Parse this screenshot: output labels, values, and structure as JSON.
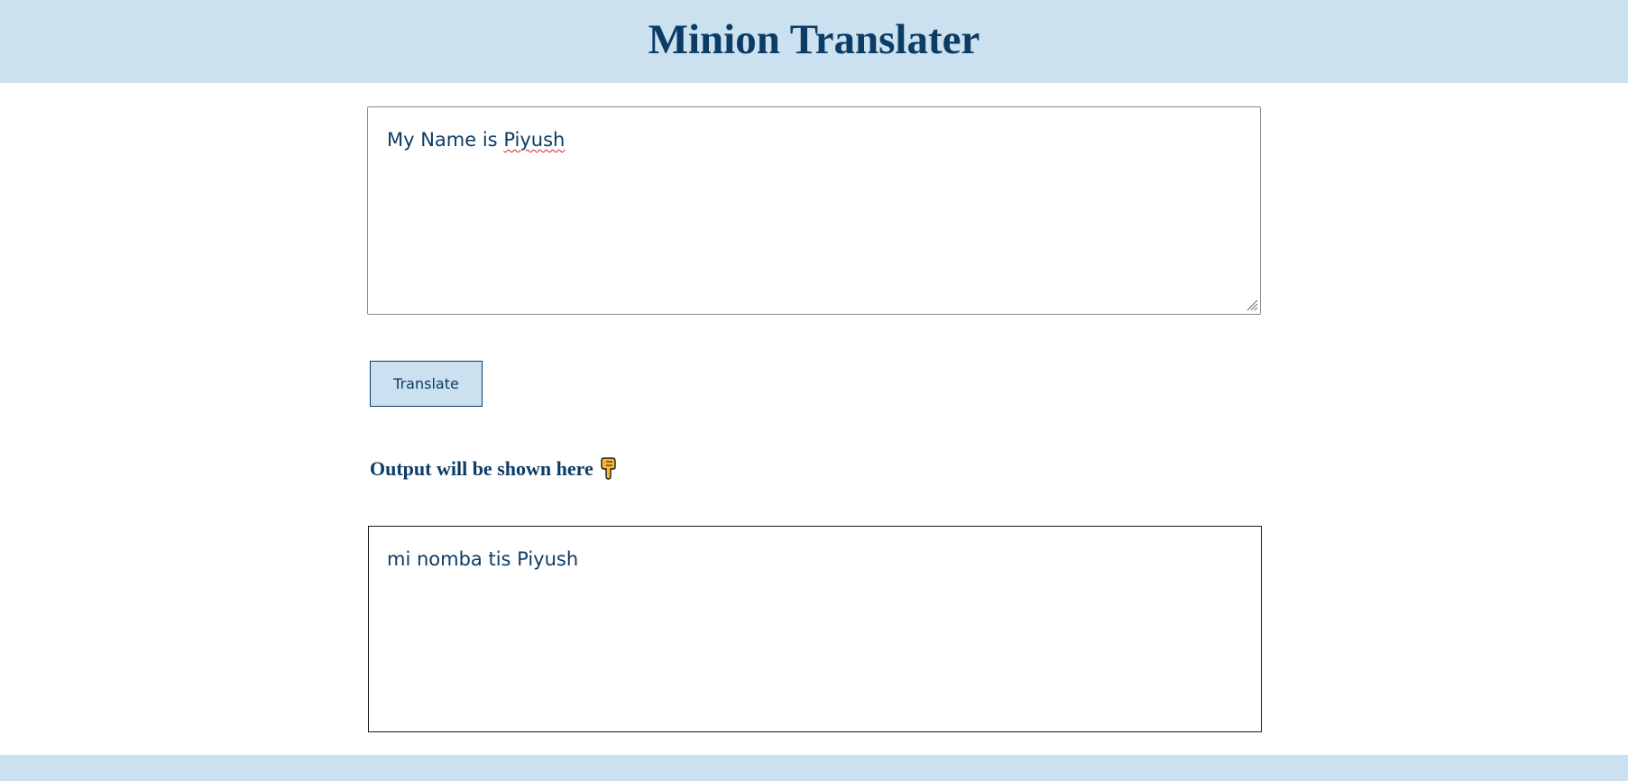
{
  "header": {
    "title": "Minion Translater"
  },
  "input": {
    "value_prefix": "My Name is ",
    "value_misspelled": "Piyush"
  },
  "actions": {
    "translate_label": "Translate"
  },
  "output": {
    "label": "Output will be shown here",
    "pointer_icon": "backhand-index-pointing-down-icon",
    "text": "mi nomba tis Piyush"
  },
  "colors": {
    "header_bg": "#cce1ef",
    "primary_text": "#0b3c66",
    "spellcheck_underline": "#e02020"
  }
}
